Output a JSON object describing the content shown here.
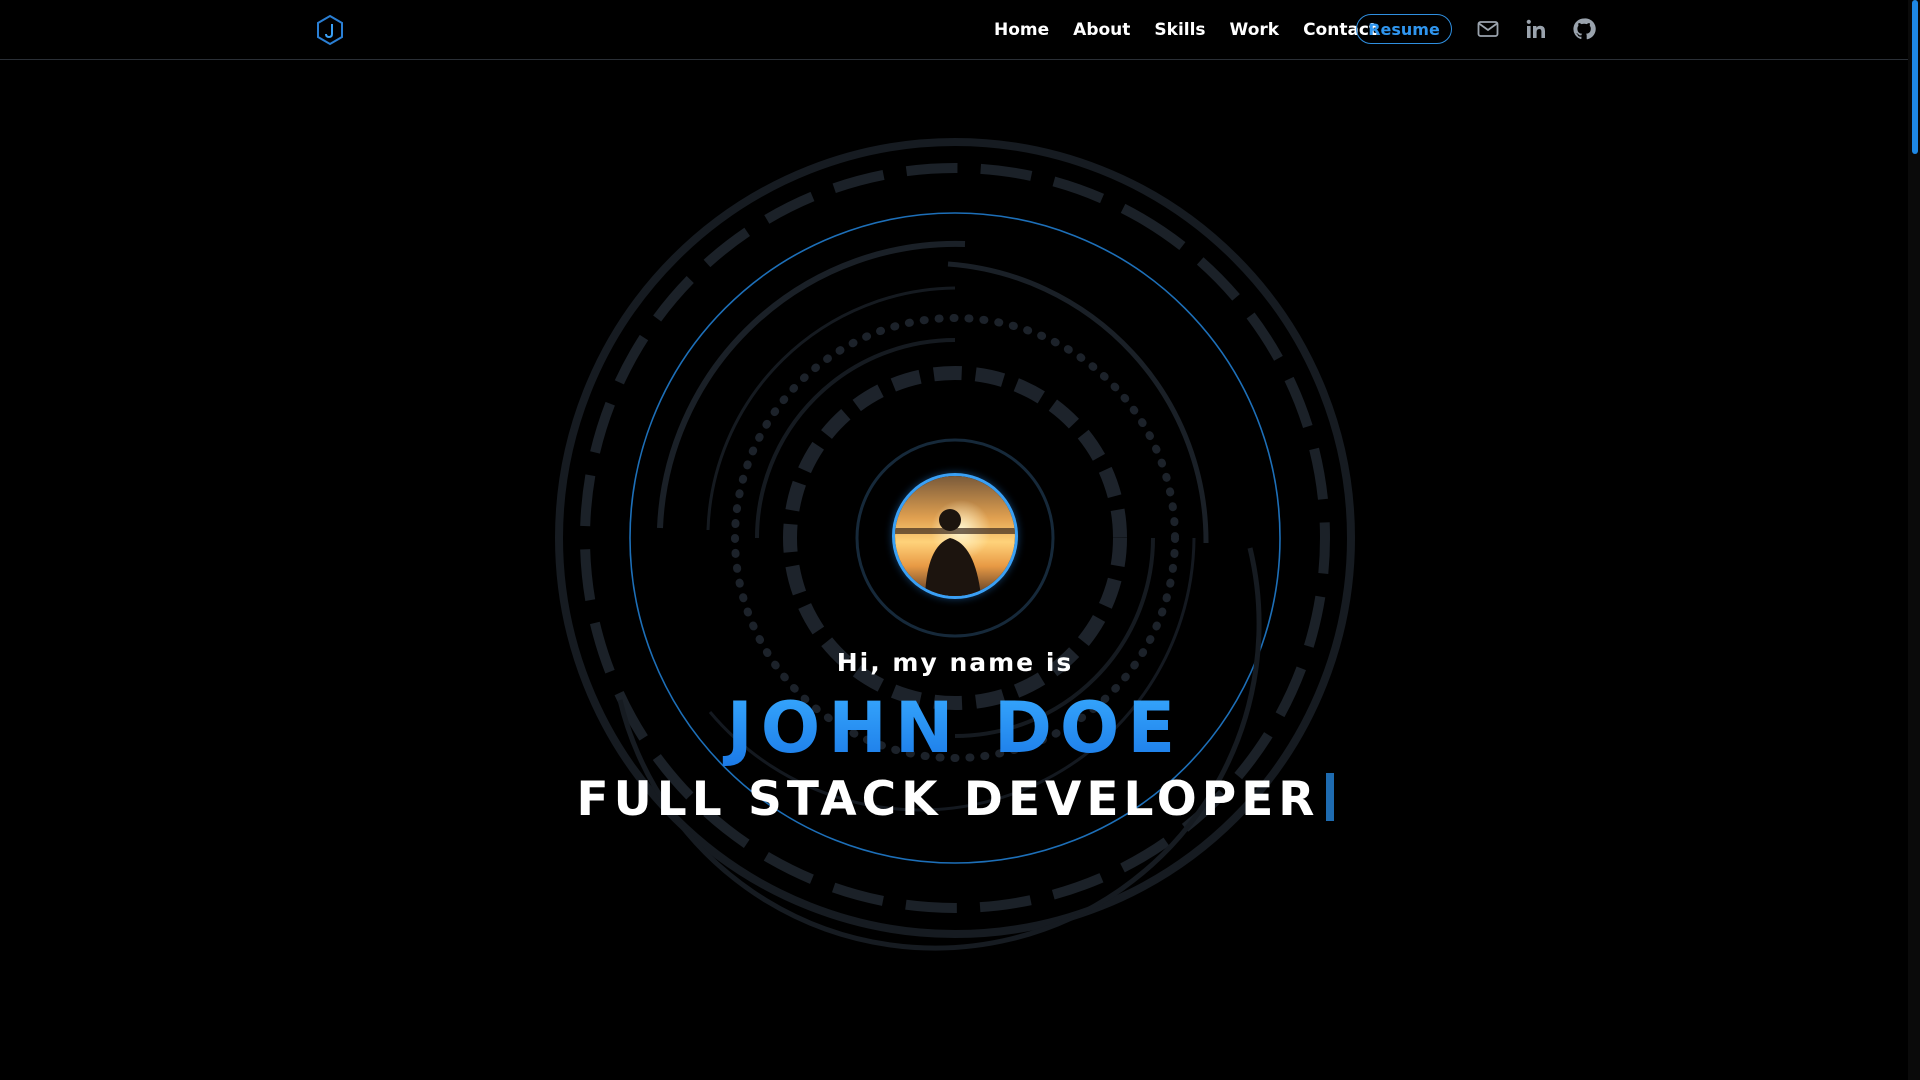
{
  "header": {
    "logo_icon": "hexagon-j-logo-icon",
    "nav": [
      {
        "label": "Home"
      },
      {
        "label": "About"
      },
      {
        "label": "Skills"
      },
      {
        "label": "Work"
      },
      {
        "label": "Contact"
      }
    ],
    "resume_label": "Resume",
    "social_icons": [
      "mail-icon",
      "linkedin-icon",
      "github-icon"
    ]
  },
  "hero": {
    "greeting": "Hi, my name is",
    "name": "JOHN DOE",
    "role": "FULL STACK DEVELOPER"
  },
  "colors": {
    "background": "#000000",
    "accent": "#1f8ff0",
    "ring": "#1a2028",
    "ring_accent": "#1d6fb8"
  }
}
